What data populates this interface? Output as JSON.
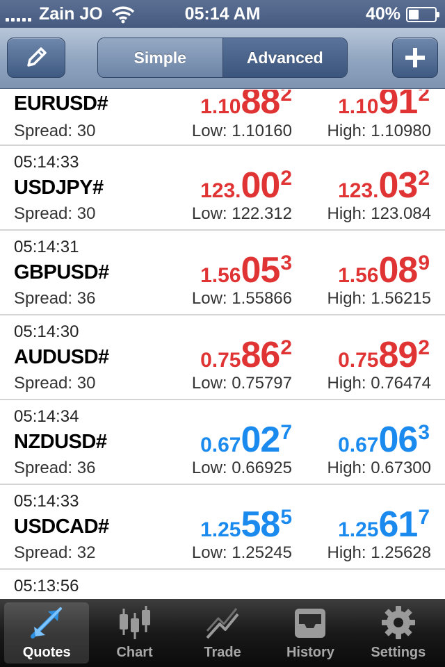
{
  "status_bar": {
    "carrier": "Zain JO",
    "time": "05:14 AM",
    "battery": "40%",
    "battery_level": 0.4
  },
  "nav": {
    "segments": [
      "Simple",
      "Advanced"
    ],
    "selected_segment": "Advanced",
    "edit_icon": "pencil-icon",
    "add_icon": "plus-icon"
  },
  "quotes": [
    {
      "time": "",
      "symbol": "EURUSD#",
      "spread": "Spread: 30",
      "low": "Low: 1.10160",
      "high": "High: 1.10980",
      "bid": {
        "small": "1.10",
        "big": "88",
        "sup": "2"
      },
      "ask": {
        "small": "1.10",
        "big": "91",
        "sup": "2"
      },
      "direction": "down"
    },
    {
      "time": "05:14:33",
      "symbol": "USDJPY#",
      "spread": "Spread: 30",
      "low": "Low: 122.312",
      "high": "High: 123.084",
      "bid": {
        "small": "123.",
        "big": "00",
        "sup": "2"
      },
      "ask": {
        "small": "123.",
        "big": "03",
        "sup": "2"
      },
      "direction": "down"
    },
    {
      "time": "05:14:31",
      "symbol": "GBPUSD#",
      "spread": "Spread: 36",
      "low": "Low: 1.55866",
      "high": "High: 1.56215",
      "bid": {
        "small": "1.56",
        "big": "05",
        "sup": "3"
      },
      "ask": {
        "small": "1.56",
        "big": "08",
        "sup": "9"
      },
      "direction": "down"
    },
    {
      "time": "05:14:30",
      "symbol": "AUDUSD#",
      "spread": "Spread: 30",
      "low": "Low: 0.75797",
      "high": "High: 0.76474",
      "bid": {
        "small": "0.75",
        "big": "86",
        "sup": "2"
      },
      "ask": {
        "small": "0.75",
        "big": "89",
        "sup": "2"
      },
      "direction": "down"
    },
    {
      "time": "05:14:34",
      "symbol": "NZDUSD#",
      "spread": "Spread: 36",
      "low": "Low: 0.66925",
      "high": "High: 0.67300",
      "bid": {
        "small": "0.67",
        "big": "02",
        "sup": "7"
      },
      "ask": {
        "small": "0.67",
        "big": "06",
        "sup": "3"
      },
      "direction": "up"
    },
    {
      "time": "05:14:33",
      "symbol": "USDCAD#",
      "spread": "Spread: 32",
      "low": "Low: 1.25245",
      "high": "High: 1.25628",
      "bid": {
        "small": "1.25",
        "big": "58",
        "sup": "5"
      },
      "ask": {
        "small": "1.25",
        "big": "61",
        "sup": "7"
      },
      "direction": "up"
    },
    {
      "time": "05:13:56",
      "symbol": "",
      "spread": "",
      "low": "",
      "high": "",
      "bid": {
        "small": "",
        "big": "",
        "sup": ""
      },
      "ask": {
        "small": "",
        "big": "",
        "sup": ""
      },
      "direction": "up"
    }
  ],
  "colors": {
    "price_down": "#e03434",
    "price_up": "#1a8aef"
  },
  "tabs": [
    {
      "label": "Quotes",
      "icon": "quotes-arrows-icon",
      "active": true
    },
    {
      "label": "Chart",
      "icon": "candlestick-icon",
      "active": false
    },
    {
      "label": "Trade",
      "icon": "trend-chart-icon",
      "active": false
    },
    {
      "label": "History",
      "icon": "inbox-tray-icon",
      "active": false
    },
    {
      "label": "Settings",
      "icon": "gear-icon",
      "active": false
    }
  ]
}
